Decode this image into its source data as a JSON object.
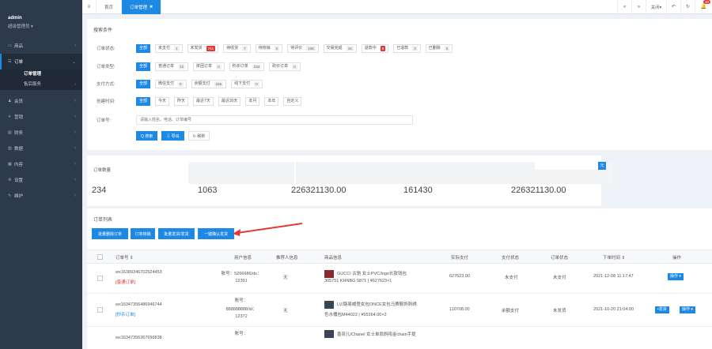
{
  "sidebar": {
    "user": {
      "name": "admin",
      "role": "超级管理员 ▾"
    },
    "items": [
      {
        "icon": "▭",
        "icon_name": "shop-icon",
        "label": "商品"
      },
      {
        "icon": "☰",
        "icon_name": "order-icon",
        "label": "订单"
      },
      {
        "icon": "♟",
        "icon_name": "member-icon",
        "label": "会员"
      },
      {
        "icon": "✈",
        "icon_name": "marketing-icon",
        "label": "营销"
      },
      {
        "icon": "▤",
        "icon_name": "finance-icon",
        "label": "财务"
      },
      {
        "icon": "▥",
        "icon_name": "data-icon",
        "label": "数据"
      },
      {
        "icon": "▦",
        "icon_name": "content-icon",
        "label": "内容"
      },
      {
        "icon": "⚙",
        "icon_name": "settings-icon",
        "label": "设置"
      },
      {
        "icon": "✎",
        "icon_name": "maintain-icon",
        "label": "维护"
      }
    ],
    "sub_items": [
      {
        "label": "订单管理"
      },
      {
        "label": "售后服务"
      }
    ]
  },
  "topbar": {
    "home_tab": "首页",
    "active_tab": "订单管理",
    "close_label": "关闭▾",
    "notify_count": "10"
  },
  "search": {
    "title": "搜索条件",
    "status_label": "订单状态:",
    "statuses": [
      {
        "label": "全部",
        "count": ""
      },
      {
        "label": "未支付",
        "count": "1"
      },
      {
        "label": "未发货",
        "count": "741"
      },
      {
        "label": "待收货",
        "count": "7"
      },
      {
        "label": "待核销",
        "count": "0"
      },
      {
        "label": "待评价",
        "count": "108"
      },
      {
        "label": "交易完成",
        "count": "16"
      },
      {
        "label": "退款中",
        "count": "6"
      },
      {
        "label": "已退款",
        "count": "3"
      },
      {
        "label": "已删除",
        "count": "5"
      }
    ],
    "type_label": "订单类型:",
    "types": [
      {
        "label": "全部",
        "count": ""
      },
      {
        "label": "普通订单",
        "count": "12"
      },
      {
        "label": "拼团订单",
        "count": "0"
      },
      {
        "label": "秒杀订单",
        "count": "233"
      },
      {
        "label": "砍价订单",
        "count": "0"
      }
    ],
    "pay_label": "支付方式:",
    "pays": [
      {
        "label": "全部",
        "count": ""
      },
      {
        "label": "微信支付",
        "count": "0"
      },
      {
        "label": "余额支付",
        "count": "245"
      },
      {
        "label": "线下支付",
        "count": "0"
      }
    ],
    "time_label": "创建时间:",
    "times": [
      "全部",
      "今天",
      "昨天",
      "最近7天",
      "最近30天",
      "本月",
      "本年",
      "自定义"
    ],
    "keyword_label": "订单号:",
    "keyword_placeholder": "请输入姓名、电话、订单编号",
    "btn_search": "Q 搜索",
    "btn_export": "⇩ 导出",
    "btn_refresh": "↻ 刷新"
  },
  "stats": {
    "label": "订单数量",
    "values": [
      "234",
      "1063",
      "226321130.00",
      "161430",
      "226321130.00"
    ],
    "side_btn": "元"
  },
  "list": {
    "title": "订单列表",
    "buttons": [
      "批量删除订单",
      "订单核销",
      "批量发货/发货",
      "一键确认发货"
    ],
    "columns": [
      "订单号 ⇕",
      "用户信息",
      "推荐人信息",
      "商品信息",
      "实际支付",
      "支付状态",
      "订单状态",
      "下单时间 ⇕",
      "操作"
    ],
    "rows": [
      {
        "order_no": "wx16389346702524453",
        "order_type": "[普通订单]",
        "user_line1": "账号：5266686/ds：",
        "user_line2": "12391",
        "referrer": "无",
        "product_line1": "GUCCI 古驰 女士PVC/logo长款钱包",
        "product_line2": "305751 KHNBG 5871 | ¥627623×1",
        "paid": "627623.00",
        "pay_status": "未支付",
        "order_status": "未支付",
        "created": "2021-12-08 11:17:47",
        "actions": [
          "操作 ▾"
        ]
      },
      {
        "order_no": "wx16347356486946744",
        "order_type": "[秒杀订单]",
        "user_line1": "账号：",
        "user_line2": "888888888/id：",
        "user_line3": "12372",
        "referrer": "无",
        "product_line1": "LV/路易威登女包ONCE女包马赛鞍饰刺绣",
        "product_line2": "色水桶包M44022 | ¥65364.00×2",
        "paid": "110708.00",
        "pay_status": "余额支付",
        "order_status": "未发货",
        "created": "2021-10-20 21:04:00",
        "actions": [
          "▪发货",
          "操作 ▾"
        ]
      },
      {
        "order_no": "wx16347356367696838",
        "user_line1": "账号：",
        "product_line1": "香奈儿/Chanel 女士单肩斜挎金chain手提"
      }
    ]
  }
}
